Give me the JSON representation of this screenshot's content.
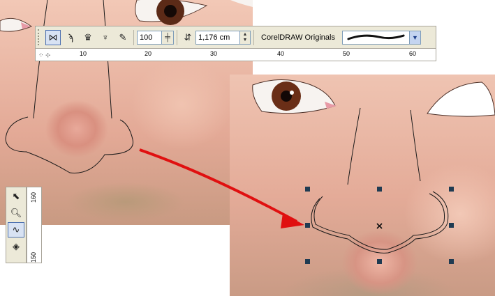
{
  "toolbar": {
    "outline_width_value": "100",
    "size_value": "1,176 cm",
    "preset_label": "CorelDRAW Originals",
    "icons": [
      "node-edit-icon",
      "freehand-icon",
      "pressure-icon",
      "calligraphic-icon",
      "brush-icon"
    ]
  },
  "ruler": {
    "h_ticks": [
      "10",
      "20",
      "30",
      "40",
      "50",
      "60"
    ],
    "v_ticks": [
      "160",
      "150"
    ]
  },
  "toolbox": {
    "tools": [
      "shape-tool-icon",
      "zoom-icon",
      "freehand-curve-icon",
      "fill-tool-icon"
    ]
  },
  "colors": {
    "arrow": "#e01010",
    "toolbar_bg": "#ece9d8",
    "selection_handle": "#1f3b52"
  }
}
